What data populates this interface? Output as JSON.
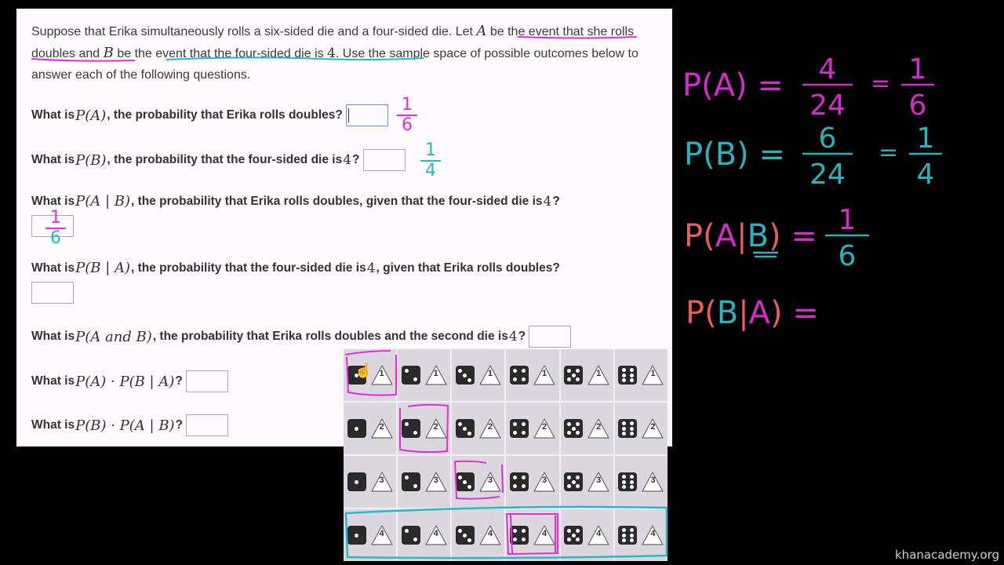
{
  "problem": {
    "intro_parts": [
      "Suppose that Erika simultaneously rolls a six-sided die and a four-sided die. Let ",
      "A",
      " be the event that she rolls doubles and ",
      "B",
      " be the event that the four-sided die is ",
      "4",
      ". Use the sample space of possible outcomes below to answer each of the following questions."
    ]
  },
  "questions": [
    {
      "prefix": "What is ",
      "math": "P(A)",
      "suffix": ", the probability that Erika rolls doubles?",
      "answer_value": "",
      "handwritten": {
        "num": "1",
        "den": "6",
        "num_color": "#e02fd4",
        "den_color": "#e02fd4"
      }
    },
    {
      "prefix": "What is ",
      "math": "P(B)",
      "suffix": ", the probability that the four-sided die is ",
      "math2": "4",
      "suffix2": "?",
      "answer_value": "",
      "handwritten": {
        "num": "1",
        "den": "4",
        "num_color": "#28b9c8",
        "den_color": "#28b9c8"
      }
    },
    {
      "prefix": "What is ",
      "math": "P(A | B)",
      "suffix": ", the probability that Erika rolls doubles, given that the four-sided die is ",
      "math2": "4",
      "suffix2": "?",
      "answer_value": "",
      "handwritten": {
        "num": "1",
        "den": "6",
        "num_color": "#e02fd4",
        "den_color": "#28b9c8"
      }
    },
    {
      "prefix": "What is ",
      "math": "P(B | A)",
      "suffix": ", the probability that the four-sided die is ",
      "math2": "4",
      "suffix2": ", given that Erika rolls doubles?",
      "answer_value": ""
    },
    {
      "prefix": "What is ",
      "math": "P(A and B)",
      "suffix": ", the probability that Erika rolls doubles and the second die is ",
      "math2": "4",
      "suffix2": "?",
      "answer_value": ""
    },
    {
      "prefix": "What is ",
      "math": "P(A) · P(B | A)",
      "suffix": "?",
      "answer_value": ""
    },
    {
      "prefix": "What is ",
      "math": "P(B) · P(A | B)",
      "suffix": "?",
      "answer_value": ""
    }
  ],
  "sample_space": {
    "d6_faces": [
      1,
      2,
      3,
      4,
      5,
      6
    ],
    "d4_faces": [
      1,
      2,
      3,
      4
    ],
    "highlighted_doubles": [
      [
        1,
        1
      ],
      [
        2,
        2
      ],
      [
        3,
        3
      ],
      [
        4,
        4
      ]
    ],
    "highlighted_row": 4,
    "annotation_colors": {
      "doubles": "#e02fd4",
      "event_b": "#28b9c8"
    }
  },
  "board": {
    "lines": [
      {
        "lhs": "P(A)",
        "eq1": "4/24",
        "eq2": "1/6",
        "color": "#d42cc8"
      },
      {
        "lhs": "P(B)",
        "eq1": "6/24",
        "eq2": "1/4",
        "color": "#2bb3bd"
      },
      {
        "lhs": "P(A|B)",
        "eq1": "1/6",
        "color": "#e85d5d"
      },
      {
        "lhs": "P(B|A)",
        "eq1": "",
        "color": "#e85d5d"
      }
    ]
  },
  "watermark": "khanacademy.org"
}
